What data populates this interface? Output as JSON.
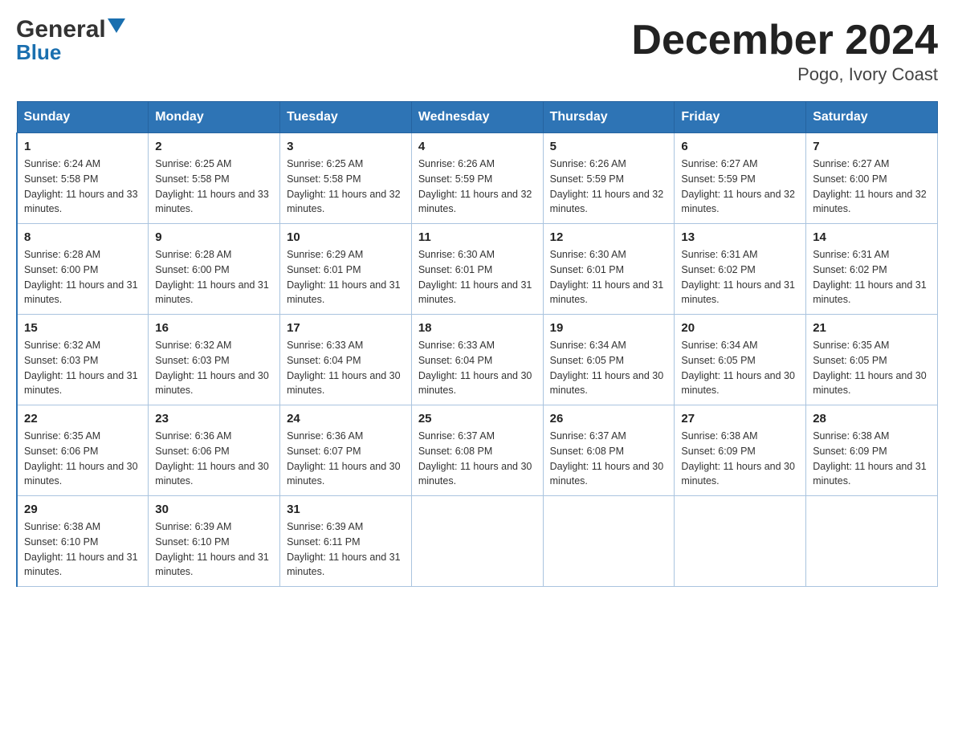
{
  "header": {
    "logo_general": "General",
    "logo_blue": "Blue",
    "title": "December 2024",
    "subtitle": "Pogo, Ivory Coast"
  },
  "calendar": {
    "days_of_week": [
      "Sunday",
      "Monday",
      "Tuesday",
      "Wednesday",
      "Thursday",
      "Friday",
      "Saturday"
    ],
    "weeks": [
      [
        {
          "day": 1,
          "sunrise": "6:24 AM",
          "sunset": "5:58 PM",
          "daylight": "11 hours and 33 minutes."
        },
        {
          "day": 2,
          "sunrise": "6:25 AM",
          "sunset": "5:58 PM",
          "daylight": "11 hours and 33 minutes."
        },
        {
          "day": 3,
          "sunrise": "6:25 AM",
          "sunset": "5:58 PM",
          "daylight": "11 hours and 32 minutes."
        },
        {
          "day": 4,
          "sunrise": "6:26 AM",
          "sunset": "5:59 PM",
          "daylight": "11 hours and 32 minutes."
        },
        {
          "day": 5,
          "sunrise": "6:26 AM",
          "sunset": "5:59 PM",
          "daylight": "11 hours and 32 minutes."
        },
        {
          "day": 6,
          "sunrise": "6:27 AM",
          "sunset": "5:59 PM",
          "daylight": "11 hours and 32 minutes."
        },
        {
          "day": 7,
          "sunrise": "6:27 AM",
          "sunset": "6:00 PM",
          "daylight": "11 hours and 32 minutes."
        }
      ],
      [
        {
          "day": 8,
          "sunrise": "6:28 AM",
          "sunset": "6:00 PM",
          "daylight": "11 hours and 31 minutes."
        },
        {
          "day": 9,
          "sunrise": "6:28 AM",
          "sunset": "6:00 PM",
          "daylight": "11 hours and 31 minutes."
        },
        {
          "day": 10,
          "sunrise": "6:29 AM",
          "sunset": "6:01 PM",
          "daylight": "11 hours and 31 minutes."
        },
        {
          "day": 11,
          "sunrise": "6:30 AM",
          "sunset": "6:01 PM",
          "daylight": "11 hours and 31 minutes."
        },
        {
          "day": 12,
          "sunrise": "6:30 AM",
          "sunset": "6:01 PM",
          "daylight": "11 hours and 31 minutes."
        },
        {
          "day": 13,
          "sunrise": "6:31 AM",
          "sunset": "6:02 PM",
          "daylight": "11 hours and 31 minutes."
        },
        {
          "day": 14,
          "sunrise": "6:31 AM",
          "sunset": "6:02 PM",
          "daylight": "11 hours and 31 minutes."
        }
      ],
      [
        {
          "day": 15,
          "sunrise": "6:32 AM",
          "sunset": "6:03 PM",
          "daylight": "11 hours and 31 minutes."
        },
        {
          "day": 16,
          "sunrise": "6:32 AM",
          "sunset": "6:03 PM",
          "daylight": "11 hours and 30 minutes."
        },
        {
          "day": 17,
          "sunrise": "6:33 AM",
          "sunset": "6:04 PM",
          "daylight": "11 hours and 30 minutes."
        },
        {
          "day": 18,
          "sunrise": "6:33 AM",
          "sunset": "6:04 PM",
          "daylight": "11 hours and 30 minutes."
        },
        {
          "day": 19,
          "sunrise": "6:34 AM",
          "sunset": "6:05 PM",
          "daylight": "11 hours and 30 minutes."
        },
        {
          "day": 20,
          "sunrise": "6:34 AM",
          "sunset": "6:05 PM",
          "daylight": "11 hours and 30 minutes."
        },
        {
          "day": 21,
          "sunrise": "6:35 AM",
          "sunset": "6:05 PM",
          "daylight": "11 hours and 30 minutes."
        }
      ],
      [
        {
          "day": 22,
          "sunrise": "6:35 AM",
          "sunset": "6:06 PM",
          "daylight": "11 hours and 30 minutes."
        },
        {
          "day": 23,
          "sunrise": "6:36 AM",
          "sunset": "6:06 PM",
          "daylight": "11 hours and 30 minutes."
        },
        {
          "day": 24,
          "sunrise": "6:36 AM",
          "sunset": "6:07 PM",
          "daylight": "11 hours and 30 minutes."
        },
        {
          "day": 25,
          "sunrise": "6:37 AM",
          "sunset": "6:08 PM",
          "daylight": "11 hours and 30 minutes."
        },
        {
          "day": 26,
          "sunrise": "6:37 AM",
          "sunset": "6:08 PM",
          "daylight": "11 hours and 30 minutes."
        },
        {
          "day": 27,
          "sunrise": "6:38 AM",
          "sunset": "6:09 PM",
          "daylight": "11 hours and 30 minutes."
        },
        {
          "day": 28,
          "sunrise": "6:38 AM",
          "sunset": "6:09 PM",
          "daylight": "11 hours and 31 minutes."
        }
      ],
      [
        {
          "day": 29,
          "sunrise": "6:38 AM",
          "sunset": "6:10 PM",
          "daylight": "11 hours and 31 minutes."
        },
        {
          "day": 30,
          "sunrise": "6:39 AM",
          "sunset": "6:10 PM",
          "daylight": "11 hours and 31 minutes."
        },
        {
          "day": 31,
          "sunrise": "6:39 AM",
          "sunset": "6:11 PM",
          "daylight": "11 hours and 31 minutes."
        },
        null,
        null,
        null,
        null
      ]
    ]
  }
}
